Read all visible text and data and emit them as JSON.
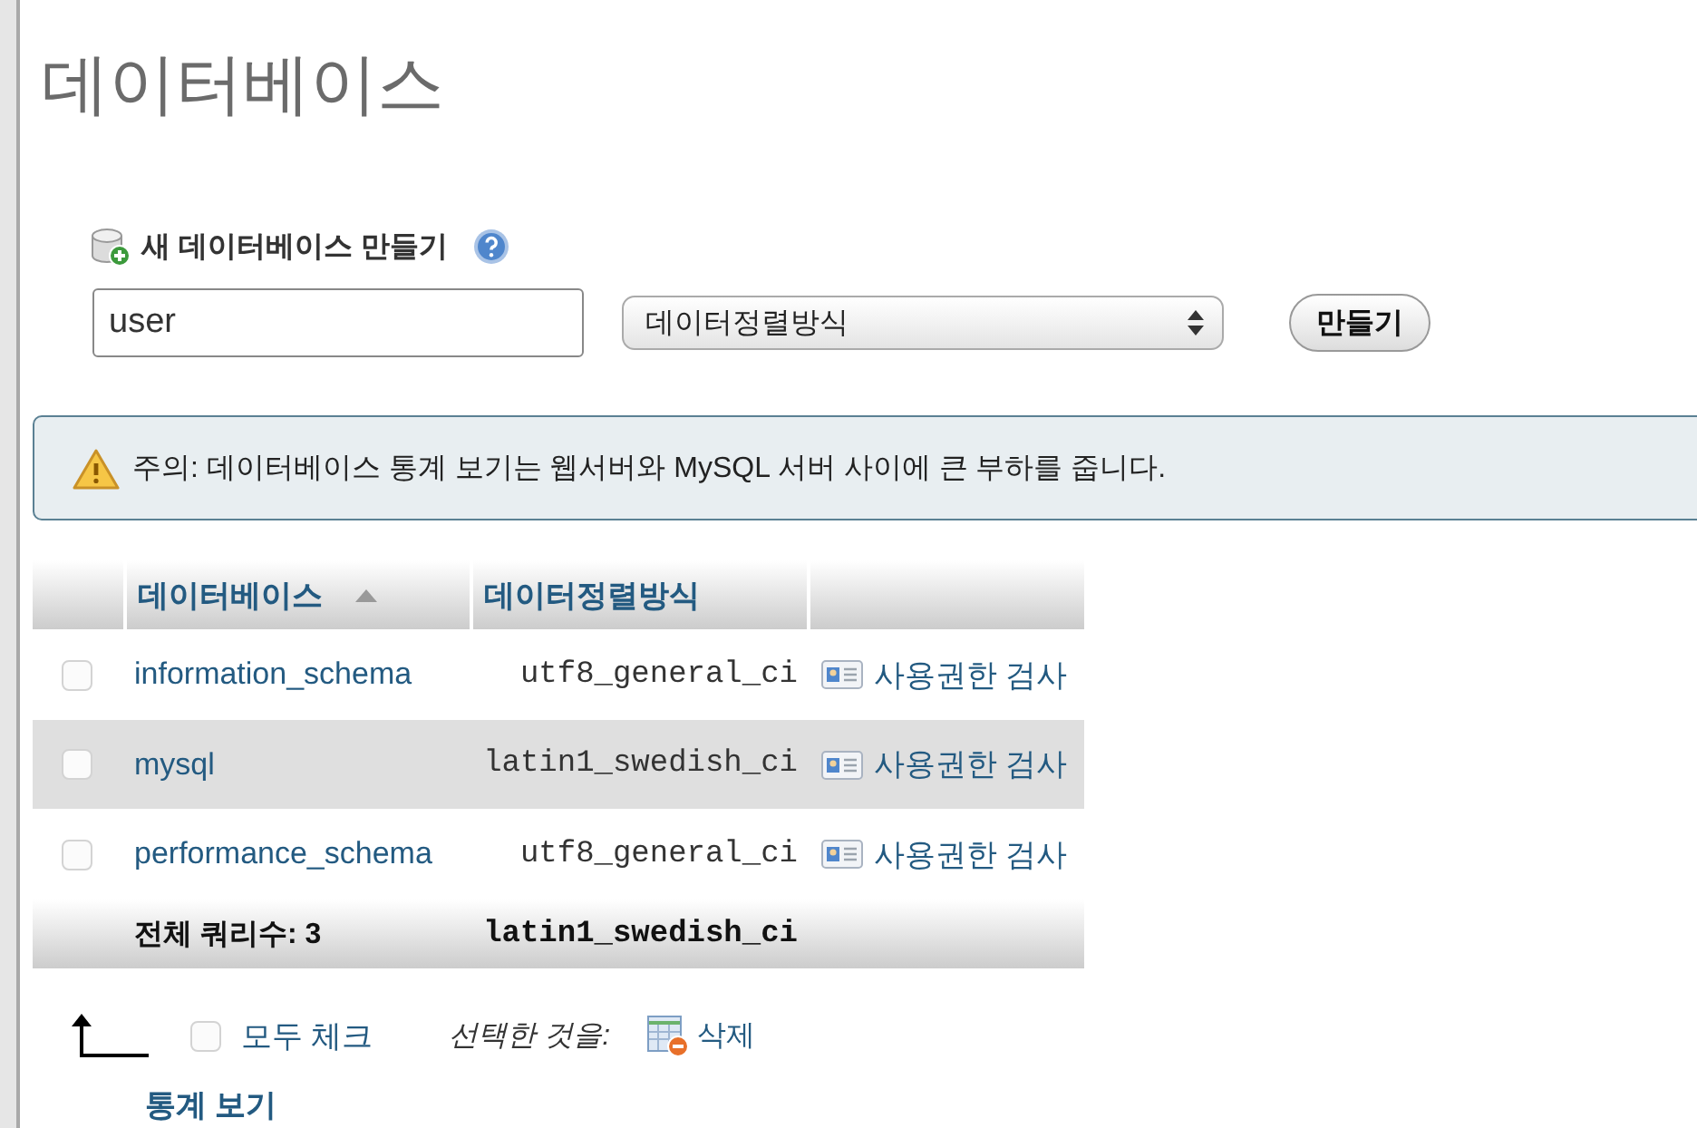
{
  "page": {
    "title": "데이터베이스"
  },
  "create_database": {
    "label": "새 데이터베이스 만들기",
    "name_field": {
      "value": "user"
    },
    "collation_select": {
      "value": "데이터정렬방식"
    },
    "create_button": "만들기"
  },
  "notice": {
    "text": "주의: 데이터베이스 통계 보기는 웹서버와 MySQL 서버 사이에 큰 부하를 줍니다."
  },
  "table": {
    "columns": [
      {
        "label": "데이터베이스",
        "sorted": true
      },
      {
        "label": "데이터정렬방식",
        "sorted": false
      }
    ],
    "rows": [
      {
        "name": "information_schema",
        "collation": "utf8_general_ci",
        "action": "사용권한 검사",
        "checked": false
      },
      {
        "name": "mysql",
        "collation": "latin1_swedish_ci",
        "action": "사용권한 검사",
        "checked": false
      },
      {
        "name": "performance_schema",
        "collation": "utf8_general_ci",
        "action": "사용권한 검사",
        "checked": false
      }
    ],
    "footer": {
      "label": "전체 쿼리수: 3",
      "collation": "latin1_swedish_ci"
    }
  },
  "bulk_actions": {
    "check_all": {
      "label": "모두 체크",
      "checked": false
    },
    "with_selected": "선택한 것을:",
    "delete": "삭제"
  },
  "statistics_link": "통계 보기"
}
